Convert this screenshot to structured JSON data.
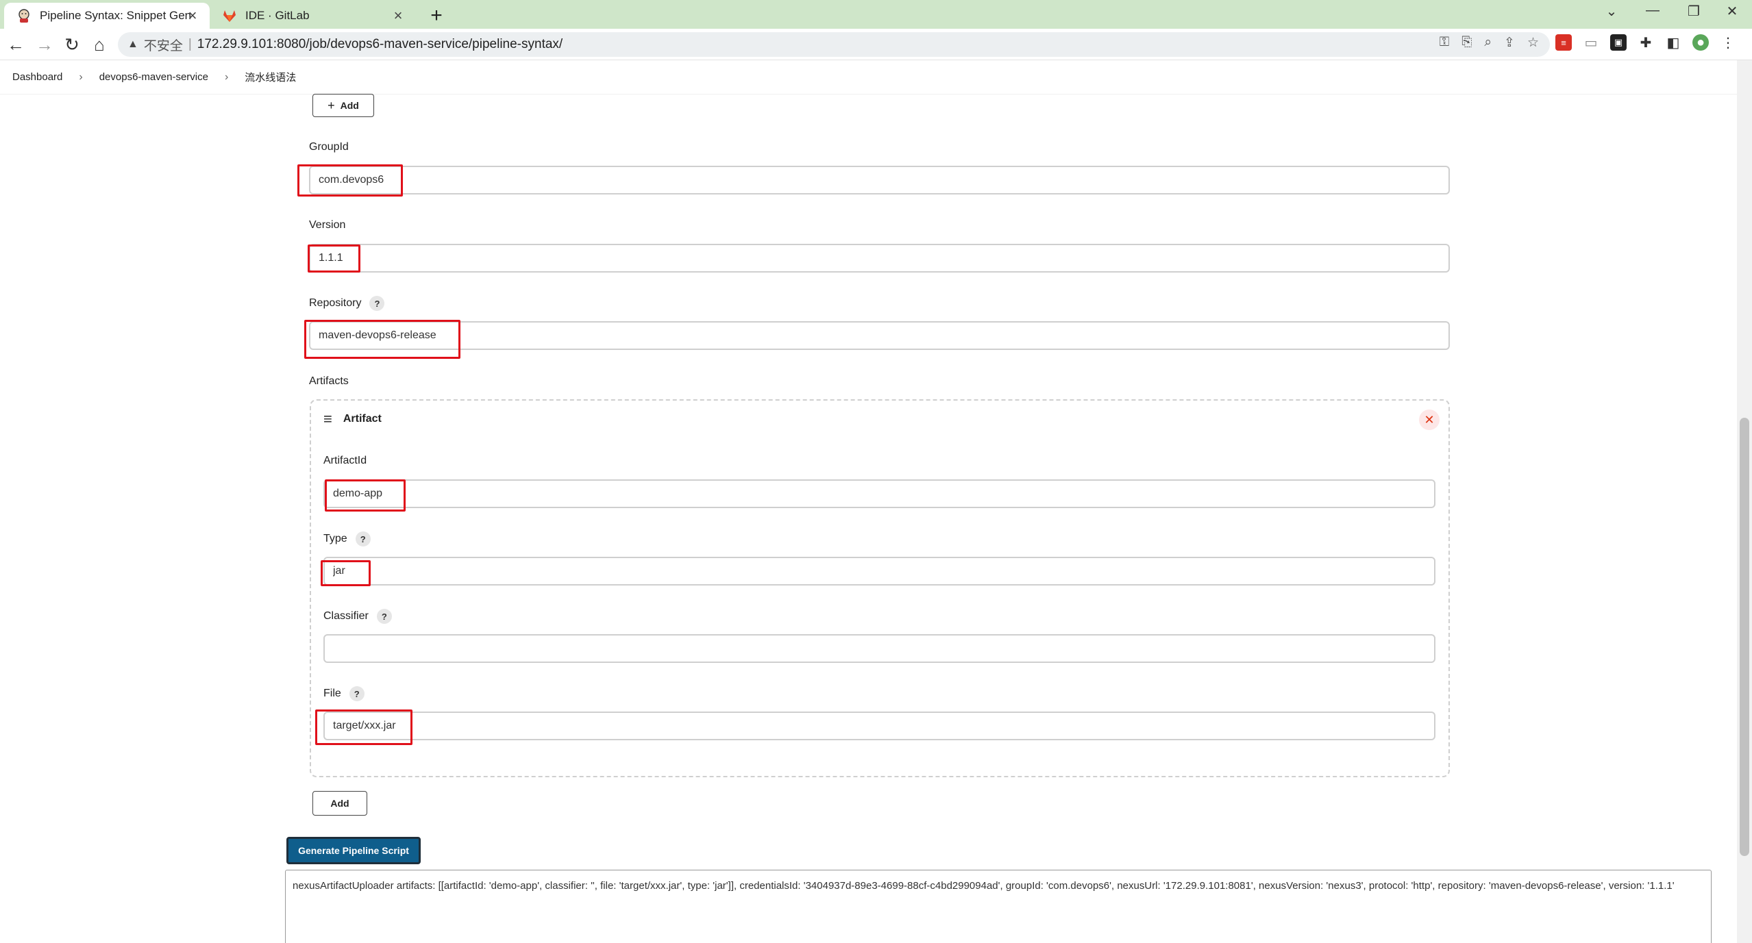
{
  "browser": {
    "tabs": [
      {
        "title": "Pipeline Syntax: Snippet Generator",
        "active": true
      },
      {
        "title": "IDE · GitLab",
        "active": false
      }
    ],
    "new_tab_glyph": "+",
    "address": {
      "security_label": "不安全",
      "url": "172.29.9.101:8080/job/devops6-maven-service/pipeline-syntax/"
    }
  },
  "breadcrumb": {
    "items": [
      "Dashboard",
      "devops6-maven-service",
      "流水线语法"
    ]
  },
  "form": {
    "top_add_label": "Add",
    "group_id": {
      "label": "GroupId",
      "value": "com.devops6"
    },
    "version": {
      "label": "Version",
      "value": "1.1.1"
    },
    "repository": {
      "label": "Repository",
      "value": "maven-devops6-release"
    },
    "artifacts_label": "Artifacts",
    "artifact": {
      "header": "Artifact",
      "artifact_id": {
        "label": "ArtifactId",
        "value": "demo-app"
      },
      "type": {
        "label": "Type",
        "value": "jar"
      },
      "classifier": {
        "label": "Classifier",
        "value": ""
      },
      "file": {
        "label": "File",
        "value": "target/xxx.jar"
      }
    },
    "artifact_add_label": "Add",
    "generate_label": "Generate Pipeline Script",
    "help_glyph": "?"
  },
  "result": {
    "script": "nexusArtifactUploader artifacts: [[artifactId: 'demo-app', classifier: '', file: 'target/xxx.jar', type: 'jar']], credentialsId: '3404937d-89e3-4699-88cf-c4bd299094ad', groupId: 'com.devops6', nexusUrl: '172.29.9.101:8081', nexusVersion: 'nexus3', protocol: 'http', repository: 'maven-devops6-release', version: '1.1.1'"
  },
  "colors": {
    "tabbar": "#cfe6c9",
    "highlight_box": "#e0101a",
    "generate_button": "#0f5e8c"
  }
}
